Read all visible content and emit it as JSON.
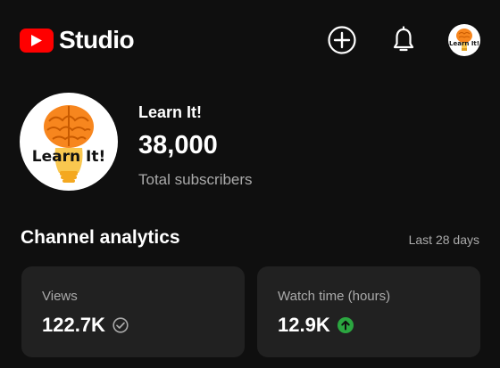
{
  "header": {
    "app_name": "Studio",
    "create_icon": "create-plus-icon",
    "notifications_icon": "bell-icon",
    "account_icon": "channel-avatar"
  },
  "channel": {
    "name": "Learn It!",
    "subscribers": "38,000",
    "subscribers_label": "Total subscribers",
    "logo_text": "Learn It!"
  },
  "analytics": {
    "title": "Channel analytics",
    "period": "Last 28 days",
    "cards": [
      {
        "label": "Views",
        "value": "122.7K",
        "status_icon": "check-circle-icon"
      },
      {
        "label": "Watch time (hours)",
        "value": "12.9K",
        "status_icon": "arrow-up-circle-icon"
      }
    ]
  },
  "colors": {
    "brand_red": "#ff0000",
    "background": "#0f0f0f",
    "card": "#212121",
    "muted_text": "#aaaaaa",
    "success_green": "#2ba640",
    "logo_orange": "#f7861e",
    "logo_yellow": "#f9c74f"
  }
}
